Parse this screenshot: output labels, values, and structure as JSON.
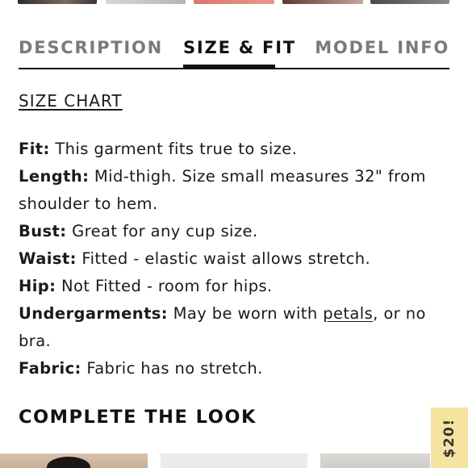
{
  "tabs": {
    "description": "DESCRIPTION",
    "size_fit": "SIZE & FIT",
    "model_info": "MODEL INFO",
    "active": "size_fit"
  },
  "size_chart_link": "SIZE CHART",
  "details": {
    "fit": {
      "label": "Fit:",
      "text": "This garment fits true to size."
    },
    "length": {
      "label": "Length:",
      "text": "Mid-thigh. Size small measures 32\" from shoulder to hem."
    },
    "bust": {
      "label": "Bust:",
      "text": "Great for any cup size."
    },
    "waist": {
      "label": "Waist:",
      "text": "Fitted - elastic waist allows stretch."
    },
    "hip": {
      "label": "Hip:",
      "text": "Not Fitted - room for hips."
    },
    "undergarments": {
      "label": "Undergarments:",
      "text_before": "May be worn with",
      "link": "petals",
      "text_after": ", or no bra."
    },
    "fabric": {
      "label": "Fabric:",
      "text": "Fabric has no stretch."
    }
  },
  "complete_the_look": {
    "title": "COMPLETE THE LOOK"
  },
  "promo_tab": {
    "text": "$20!",
    "color": "#f6e3a0"
  },
  "colors": {
    "accent": "#111111",
    "inactive_tab": "#7a7a7a"
  }
}
